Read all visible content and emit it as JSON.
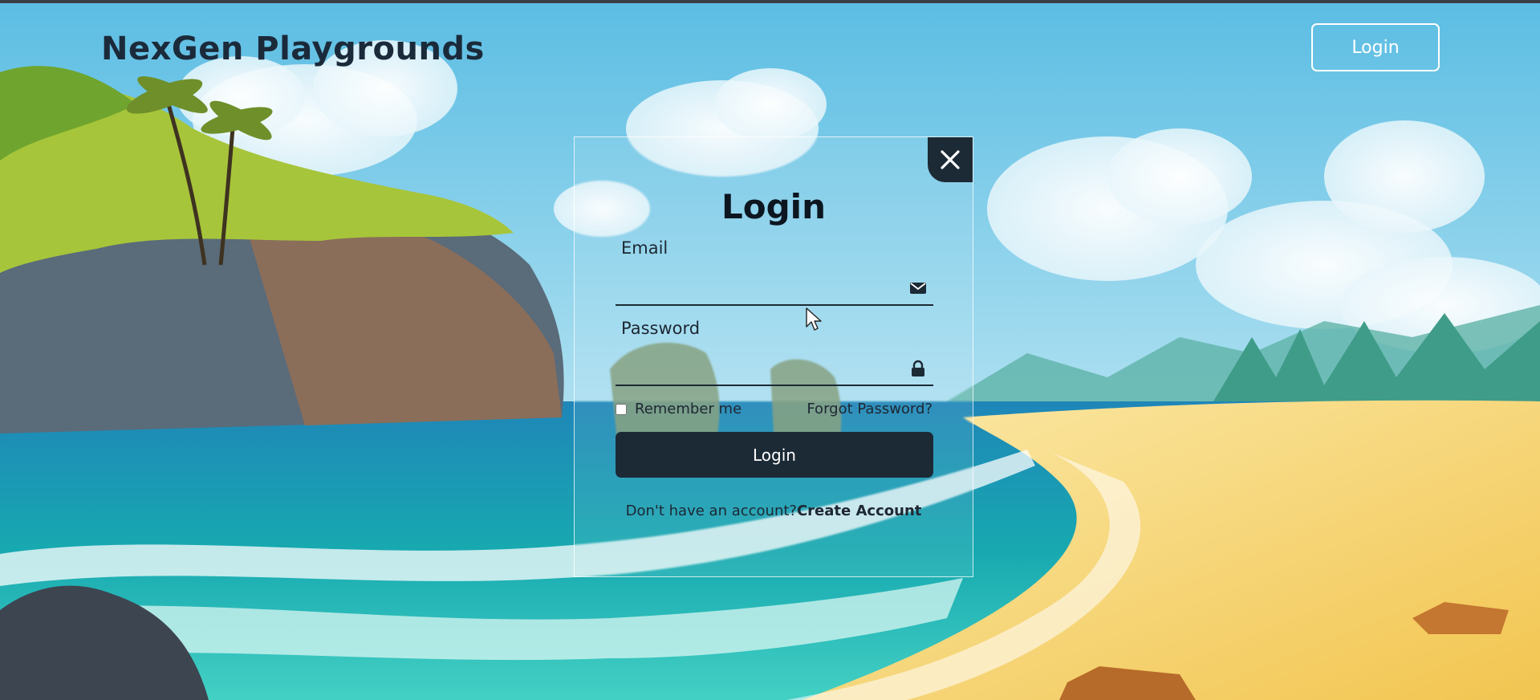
{
  "header": {
    "brand": "NexGen Playgrounds",
    "login_button": "Login"
  },
  "modal": {
    "title": "Login",
    "close_icon": "close-icon",
    "email": {
      "label": "Email",
      "value": "",
      "icon": "envelope-icon"
    },
    "password": {
      "label": "Password",
      "value": "",
      "icon": "lock-icon"
    },
    "remember_me": {
      "label": "Remember me",
      "checked": false
    },
    "forgot_password": "Forgot Password?",
    "submit_label": "Login",
    "signup_prompt": "Don't have an account?",
    "signup_link": "Create Account"
  },
  "colors": {
    "accent_dark": "#1c2a36",
    "brand_text": "#1b2a3a",
    "sky": "#6fc6e6",
    "sea": "#18b2ad",
    "sand": "#f6dd8a"
  }
}
